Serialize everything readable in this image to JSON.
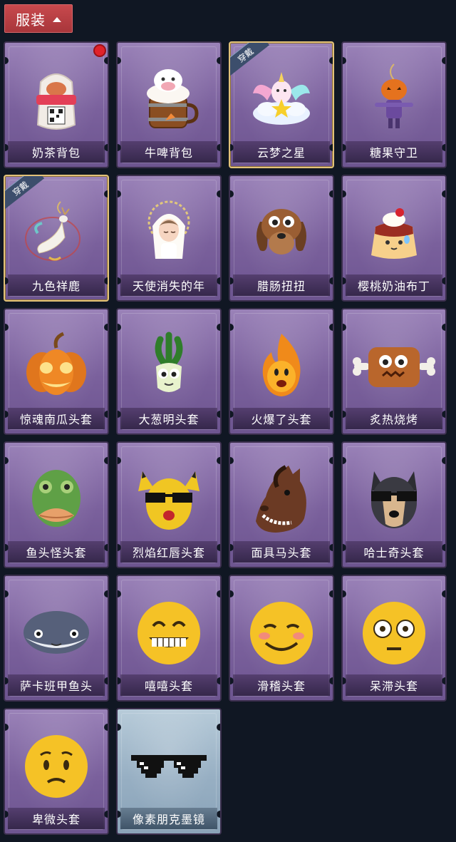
{
  "header": {
    "title": "服装",
    "toggle_icon": "chevron-up-icon"
  },
  "badge_text": "穿戴",
  "items": [
    {
      "name": "奶茶背包",
      "icon": "milk-tea-backpack-icon",
      "new": true
    },
    {
      "name": "牛啤背包",
      "icon": "beer-barrel-backpack-icon"
    },
    {
      "name": "云梦之星",
      "icon": "unicorn-cloud-star-icon",
      "equipped": true
    },
    {
      "name": "糖果守卫",
      "icon": "pumpkin-scarecrow-icon"
    },
    {
      "name": "九色祥鹿",
      "icon": "deer-charm-icon",
      "equipped": true
    },
    {
      "name": "天使消失的年",
      "icon": "angel-girl-icon"
    },
    {
      "name": "腊肠扭扭",
      "icon": "dachshund-head-icon"
    },
    {
      "name": "樱桃奶油布丁",
      "icon": "pudding-icon"
    },
    {
      "name": "惊魂南瓜头套",
      "icon": "jack-o-lantern-icon"
    },
    {
      "name": "大葱明头套",
      "icon": "scallion-head-icon"
    },
    {
      "name": "火爆了头套",
      "icon": "fire-spirit-icon"
    },
    {
      "name": "炙热烧烤",
      "icon": "bbq-meat-icon"
    },
    {
      "name": "鱼头怪头套",
      "icon": "fish-head-icon"
    },
    {
      "name": "烈焰红唇头套",
      "icon": "yellow-mask-sunglasses-icon"
    },
    {
      "name": "面具马头套",
      "icon": "horse-head-icon"
    },
    {
      "name": "哈士奇头套",
      "icon": "husky-sunglasses-icon"
    },
    {
      "name": "萨卡班甲鱼头",
      "icon": "sacabambaspis-icon"
    },
    {
      "name": "嘻嘻头套",
      "icon": "grin-emoji-icon"
    },
    {
      "name": "滑稽头套",
      "icon": "funny-emoji-icon"
    },
    {
      "name": "呆滞头套",
      "icon": "stunned-emoji-icon"
    },
    {
      "name": "卑微头套",
      "icon": "pleading-emoji-icon"
    },
    {
      "name": "像素朋克墨镜",
      "icon": "pixel-sunglasses-icon",
      "rarity": "blue"
    }
  ]
}
